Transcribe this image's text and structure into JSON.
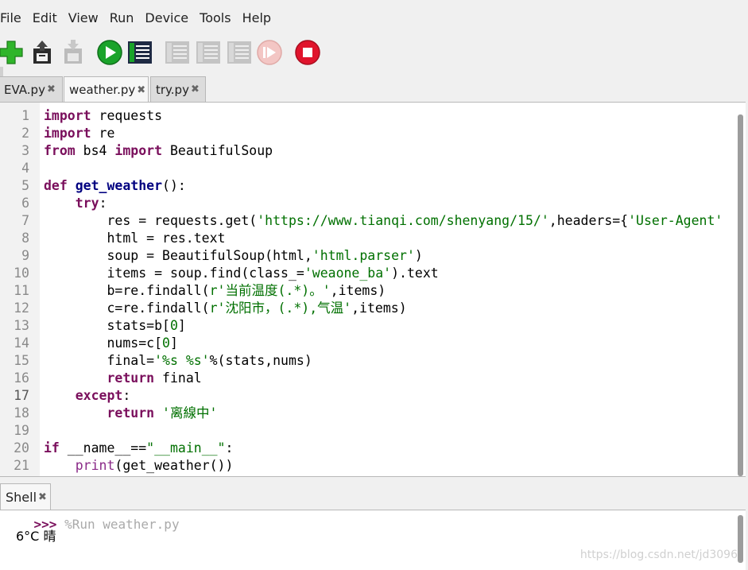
{
  "menu": [
    "File",
    "Edit",
    "View",
    "Run",
    "Device",
    "Tools",
    "Help"
  ],
  "toolbar": {
    "buttons": [
      "new-icon",
      "save-icon",
      "save-disabled-icon",
      "run-icon",
      "debug-icon",
      "step-over-icon",
      "step-into-icon",
      "step-out-icon",
      "resume-icon",
      "stop-icon"
    ],
    "colors": {
      "new": "#2fb52a",
      "run": "#1aa32a",
      "stop": "#e0142c",
      "disabled": "#bcbcbc"
    }
  },
  "tabs": [
    {
      "label": "EVA.py",
      "close": "✖"
    },
    {
      "label": "weather.py",
      "close": "✖"
    },
    {
      "label": "try.py",
      "close": "✖"
    }
  ],
  "editor": {
    "current_line": 17,
    "lines": [
      {
        "n": "1",
        "parts": [
          [
            "kw",
            "import"
          ],
          [
            "",
            " requests"
          ]
        ]
      },
      {
        "n": "2",
        "parts": [
          [
            "kw",
            "import"
          ],
          [
            "",
            " re"
          ]
        ]
      },
      {
        "n": "3",
        "parts": [
          [
            "kw",
            "from"
          ],
          [
            "",
            " bs4 "
          ],
          [
            "kw",
            "import"
          ],
          [
            "",
            " BeautifulSoup"
          ]
        ]
      },
      {
        "n": "4",
        "parts": []
      },
      {
        "n": "5",
        "parts": [
          [
            "kw",
            "def"
          ],
          [
            "",
            " "
          ],
          [
            "fn",
            "get_weather"
          ],
          [
            "",
            "():"
          ]
        ]
      },
      {
        "n": "6",
        "parts": [
          [
            "",
            "    "
          ],
          [
            "kw",
            "try"
          ],
          [
            "",
            ":"
          ]
        ]
      },
      {
        "n": "7",
        "parts": [
          [
            "",
            "        res = requests.get("
          ],
          [
            "st",
            "'https://www.tianqi.com/shenyang/15/'"
          ],
          [
            "",
            ",headers={"
          ],
          [
            "st",
            "'User-Agent'"
          ]
        ]
      },
      {
        "n": "8",
        "parts": [
          [
            "",
            "        html = res.text"
          ]
        ]
      },
      {
        "n": "9",
        "parts": [
          [
            "",
            "        soup = BeautifulSoup(html,"
          ],
          [
            "st",
            "'html.parser'"
          ],
          [
            "",
            ")"
          ]
        ]
      },
      {
        "n": "10",
        "parts": [
          [
            "",
            "        items = soup.find(class_="
          ],
          [
            "st",
            "'weaone_ba'"
          ],
          [
            "",
            ").text"
          ]
        ]
      },
      {
        "n": "11",
        "parts": [
          [
            "",
            "        b=re.findall("
          ],
          [
            "st",
            "r'当前温度(.*)。'"
          ],
          [
            "",
            ",items)"
          ]
        ]
      },
      {
        "n": "12",
        "parts": [
          [
            "",
            "        c=re.findall("
          ],
          [
            "st",
            "r'沈阳市，(.*),气温'"
          ],
          [
            "",
            ",items)"
          ]
        ]
      },
      {
        "n": "13",
        "parts": [
          [
            "",
            "        stats=b["
          ],
          [
            "nu",
            "0"
          ],
          [
            "",
            "]"
          ]
        ]
      },
      {
        "n": "14",
        "parts": [
          [
            "",
            "        nums=c["
          ],
          [
            "nu",
            "0"
          ],
          [
            "",
            "]"
          ]
        ]
      },
      {
        "n": "15",
        "parts": [
          [
            "",
            "        final="
          ],
          [
            "st",
            "'%s %s'"
          ],
          [
            "",
            "%(stats,nums)"
          ]
        ]
      },
      {
        "n": "16",
        "parts": [
          [
            "",
            "        "
          ],
          [
            "kw",
            "return"
          ],
          [
            "",
            " final"
          ]
        ]
      },
      {
        "n": "17",
        "parts": [
          [
            "",
            "    "
          ],
          [
            "kw",
            "except"
          ],
          [
            "",
            ":"
          ]
        ]
      },
      {
        "n": "18",
        "parts": [
          [
            "",
            "        "
          ],
          [
            "kw",
            "return"
          ],
          [
            "",
            " "
          ],
          [
            "st",
            "'离線中'"
          ]
        ]
      },
      {
        "n": "19",
        "parts": []
      },
      {
        "n": "20",
        "parts": [
          [
            "kw",
            "if"
          ],
          [
            "",
            " __name__=="
          ],
          [
            "st",
            "\"__main__\""
          ],
          [
            "",
            ":"
          ]
        ]
      },
      {
        "n": "21",
        "parts": [
          [
            "",
            "    "
          ],
          [
            "bi",
            "print"
          ],
          [
            "",
            "(get_weather())"
          ]
        ]
      }
    ]
  },
  "shell": {
    "tab_label": "Shell",
    "close": "✖",
    "prompt": ">>>",
    "run_command": "%Run weather.py",
    "output": "6°C 晴",
    "watermark": "https://blog.csdn.net/jd3096"
  }
}
